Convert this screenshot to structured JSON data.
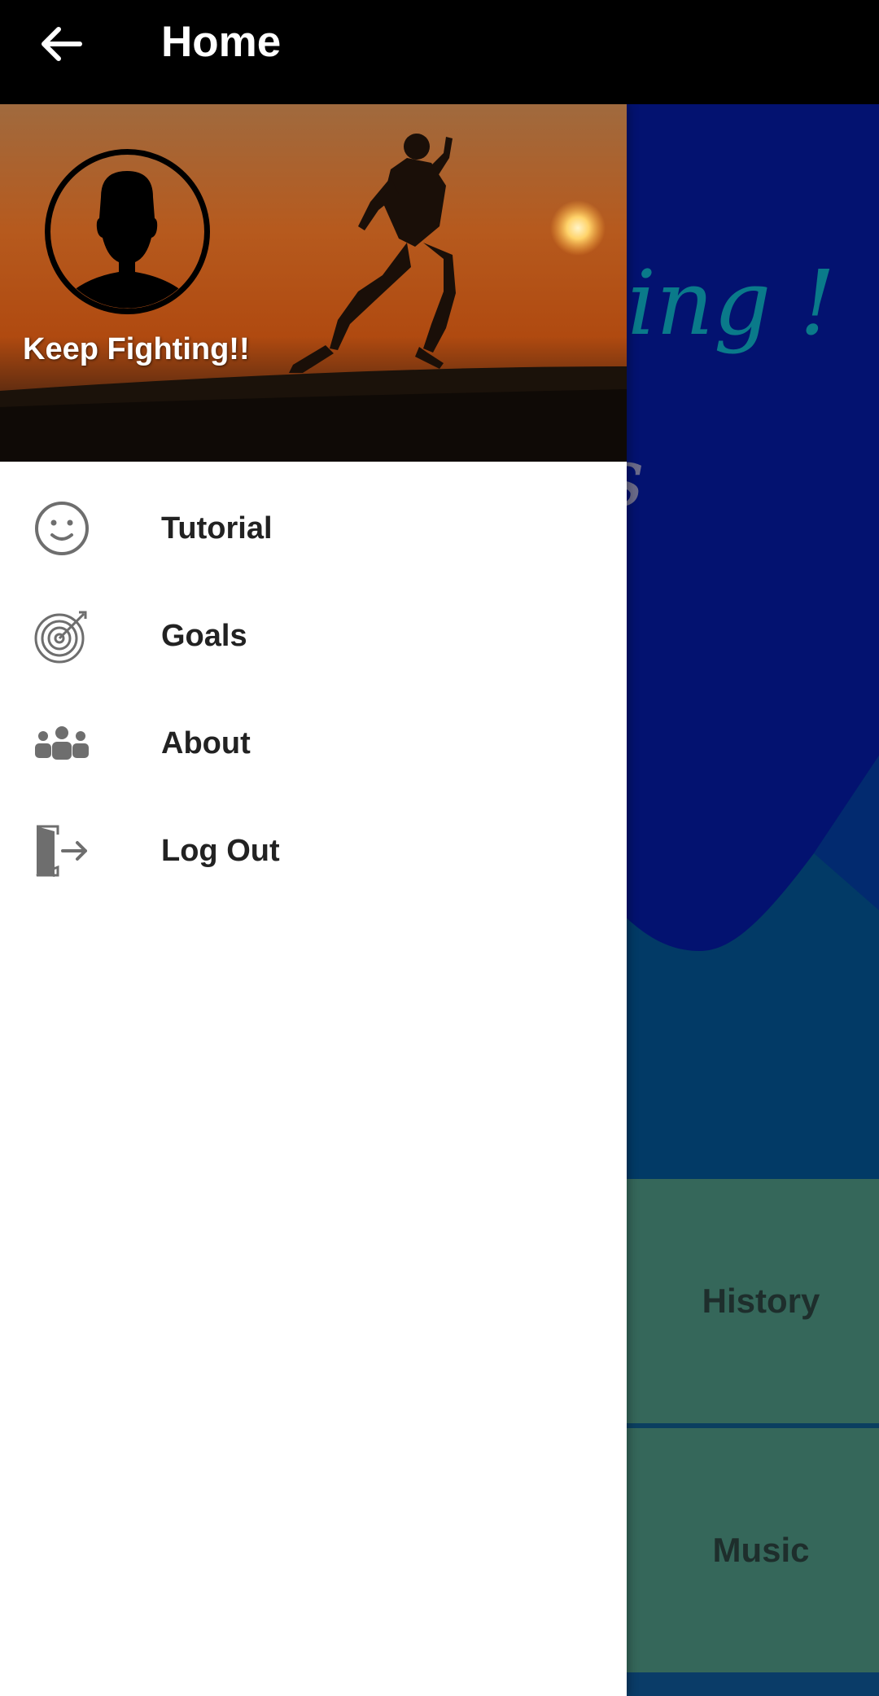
{
  "app_bar": {
    "title": "Home",
    "back_icon": "arrow-left-icon"
  },
  "drawer": {
    "header": {
      "caption": "Keep Fighting!!",
      "avatar_icon": "person-silhouette-icon"
    },
    "items": [
      {
        "label": "Tutorial",
        "icon": "smiley-face-icon"
      },
      {
        "label": "Goals",
        "icon": "target-icon"
      },
      {
        "label": "About",
        "icon": "people-group-icon"
      },
      {
        "label": "Log Out",
        "icon": "exit-door-icon"
      }
    ]
  },
  "background_screen": {
    "headline_fragment": "ning !",
    "sub_fragment": "ts",
    "tiles": [
      {
        "label": "History"
      },
      {
        "label": "Music"
      }
    ]
  },
  "colors": {
    "app_bar": "#000000",
    "drawer_bg": "#ffffff",
    "background_blue": "#031270",
    "tile_green": "#35675a",
    "icon_gray": "#6e6e6e"
  }
}
